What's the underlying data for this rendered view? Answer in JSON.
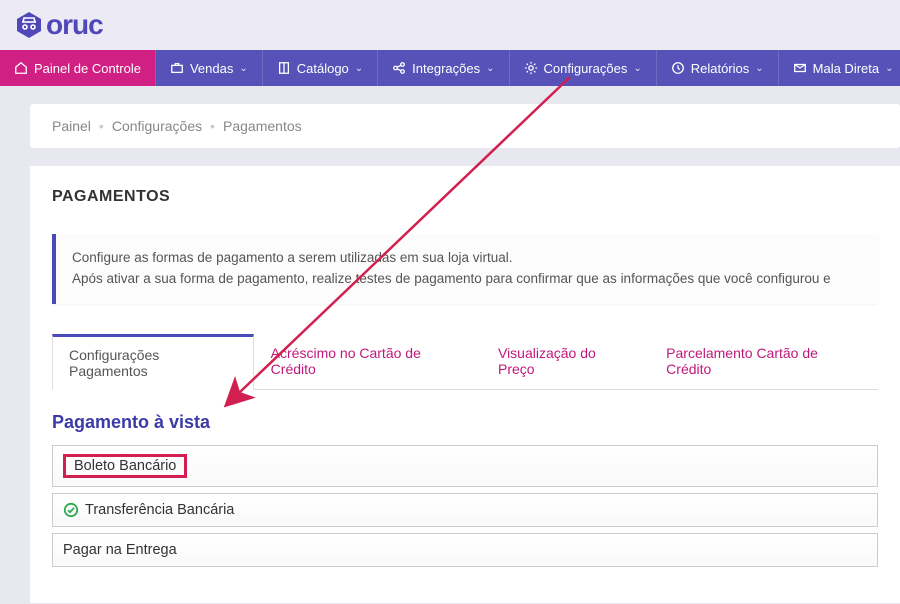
{
  "logo": {
    "text": "oruc"
  },
  "nav": {
    "items": [
      {
        "label": "Painel de Controle",
        "icon": "home",
        "active": true,
        "chevron": false
      },
      {
        "label": "Vendas",
        "icon": "briefcase",
        "chevron": true
      },
      {
        "label": "Catálogo",
        "icon": "book",
        "chevron": true
      },
      {
        "label": "Integrações",
        "icon": "share",
        "chevron": true
      },
      {
        "label": "Configurações",
        "icon": "gear",
        "chevron": true
      },
      {
        "label": "Relatórios",
        "icon": "clock",
        "chevron": true
      },
      {
        "label": "Mala Direta",
        "icon": "mail",
        "chevron": true
      }
    ]
  },
  "breadcrumb": {
    "items": [
      "Painel",
      "Configurações",
      "Pagamentos"
    ]
  },
  "panel": {
    "title": "PAGAMENTOS",
    "info_line1": "Configure as formas de pagamento a serem utilizadas em sua loja virtual.",
    "info_line2": "Após ativar a sua forma de pagamento, realize testes de pagamento para confirmar que as informações que você configurou e"
  },
  "tabs": {
    "items": [
      {
        "label": "Configurações Pagamentos",
        "active": true
      },
      {
        "label": "Acréscimo no Cartão de Crédito",
        "active": false
      },
      {
        "label": "Visualização do Preço",
        "active": false
      },
      {
        "label": "Parcelamento Cartão de Crédito",
        "active": false
      }
    ]
  },
  "section": {
    "title": "Pagamento à vista",
    "methods": [
      {
        "label": "Boleto Bancário",
        "highlighted": true,
        "checked": false
      },
      {
        "label": "Transferência Bancária",
        "highlighted": false,
        "checked": true
      },
      {
        "label": "Pagar na Entrega",
        "highlighted": false,
        "checked": false
      }
    ]
  }
}
